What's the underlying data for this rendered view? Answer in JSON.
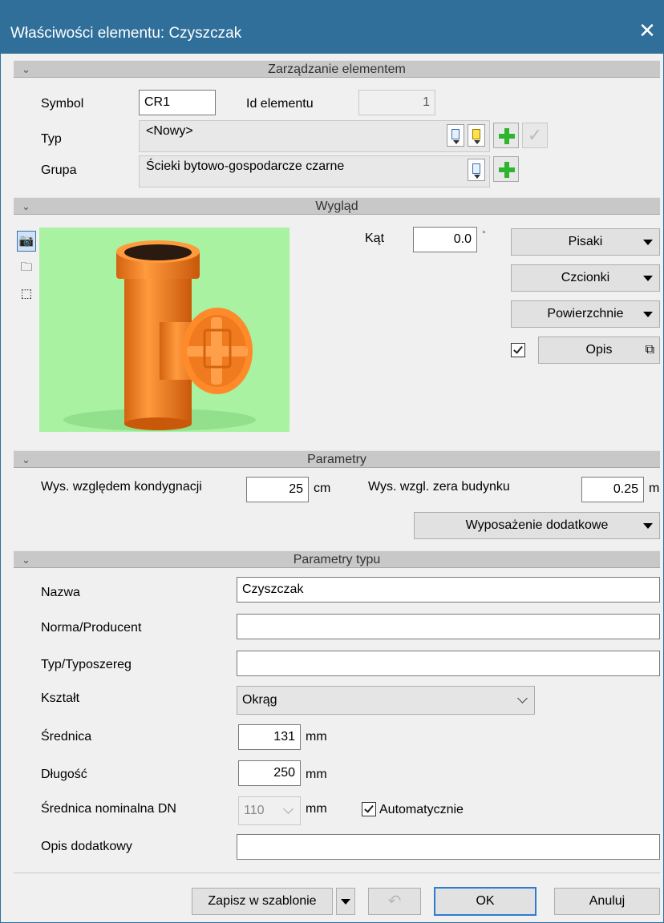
{
  "window": {
    "title": "Właściwości elementu: Czyszczak",
    "close_glyph": "✕"
  },
  "sections": {
    "management": "Zarządzanie elementem",
    "appearance": "Wygląd",
    "parameters": "Parametry",
    "type_parameters": "Parametry typu",
    "chevron": "⌄"
  },
  "management": {
    "symbol_label": "Symbol",
    "symbol_value": "CR1",
    "id_label": "Id elementu",
    "id_value": "1",
    "type_label": "Typ",
    "type_value": "<Nowy>",
    "group_label": "Grupa",
    "group_value": "Ścieki bytowo-gospodarcze czarne"
  },
  "appearance": {
    "angle_label": "Kąt",
    "angle_value": "0.0",
    "angle_unit": "°",
    "pens_button": "Pisaki",
    "fonts_button": "Czcionki",
    "surfaces_button": "Powierzchnie",
    "description_button": "Opis",
    "description_checked": true,
    "tool_icons": [
      "camera-icon",
      "folder-icon",
      "cube-icon"
    ]
  },
  "parameters": {
    "height_floor_label": "Wys. względem kondygnacji",
    "height_floor_value": "25",
    "height_floor_unit": "cm",
    "height_zero_label": "Wys. wzgl. zera budynku",
    "height_zero_value": "0.25",
    "height_zero_unit": "m",
    "extra_equipment_button": "Wyposażenie dodatkowe"
  },
  "type_parameters": {
    "name_label": "Nazwa",
    "name_value": "Czyszczak",
    "norm_label": "Norma/Producent",
    "norm_value": "",
    "series_label": "Typ/Typoszereg",
    "series_value": "",
    "shape_label": "Kształt",
    "shape_value": "Okrąg",
    "diameter_label": "Średnica",
    "diameter_value": "131",
    "diameter_unit": "mm",
    "length_label": "Długość",
    "length_value": "250",
    "length_unit": "mm",
    "dn_label": "Średnica nominalna DN",
    "dn_value": "110",
    "dn_unit": "mm",
    "auto_label": "Automatycznie",
    "auto_checked": true,
    "extra_desc_label": "Opis dodatkowy",
    "extra_desc_value": ""
  },
  "footer": {
    "save_template": "Zapisz w szablonie",
    "ok": "OK",
    "cancel": "Anuluj"
  },
  "colors": {
    "titlebar": "#2f6f9a",
    "section_header": "#c8c8c8",
    "preview_bg": "#a8f2a2",
    "pipe_orange": "#f07a1e",
    "add_green": "#2db52d"
  }
}
